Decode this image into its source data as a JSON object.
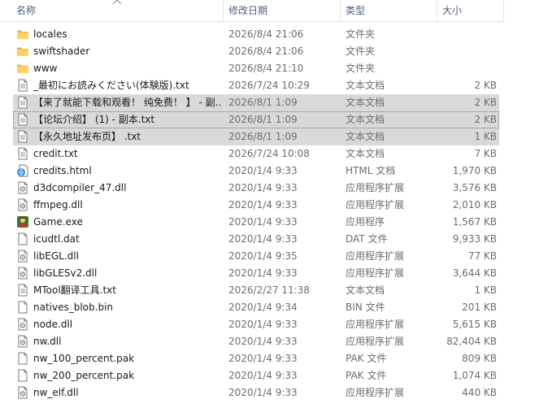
{
  "columns": {
    "name": "名称",
    "date": "修改日期",
    "type": "类型",
    "size": "大小"
  },
  "files": [
    {
      "name": "locales",
      "date": "2026/8/4 21:06",
      "type": "文件夹",
      "size": "",
      "icon": "folder-icon"
    },
    {
      "name": "swiftshader",
      "date": "2026/8/4 21:06",
      "type": "文件夹",
      "size": "",
      "icon": "folder-icon"
    },
    {
      "name": "www",
      "date": "2026/8/4 21:10",
      "type": "文件夹",
      "size": "",
      "icon": "folder-icon"
    },
    {
      "name": "_最初にお読みください(体験版).txt",
      "date": "2026/7/24 10:29",
      "type": "文本文档",
      "size": "2 KB",
      "icon": "text-file-icon"
    },
    {
      "name": "【来了就能下载和观看！ 纯免费！ 】 - 副...",
      "date": "2026/8/1 1:09",
      "type": "文本文档",
      "size": "2 KB",
      "icon": "text-file-icon",
      "selected": true
    },
    {
      "name": "【论坛介绍】 (1) - 副本.txt",
      "date": "2026/8/1 1:09",
      "type": "文本文档",
      "size": "2 KB",
      "icon": "text-file-icon",
      "selected": true,
      "focused": true
    },
    {
      "name": "【永久地址发布页】 .txt",
      "date": "2026/8/1 1:09",
      "type": "文本文档",
      "size": "1 KB",
      "icon": "text-file-icon",
      "selected": true
    },
    {
      "name": "credit.txt",
      "date": "2026/7/24 10:08",
      "type": "文本文档",
      "size": "7 KB",
      "icon": "text-file-icon"
    },
    {
      "name": "credits.html",
      "date": "2020/1/4 9:33",
      "type": "HTML 文档",
      "size": "1,970 KB",
      "icon": "html-file-icon"
    },
    {
      "name": "d3dcompiler_47.dll",
      "date": "2020/1/4 9:33",
      "type": "应用程序扩展",
      "size": "3,576 KB",
      "icon": "dll-file-icon"
    },
    {
      "name": "ffmpeg.dll",
      "date": "2020/1/4 9:33",
      "type": "应用程序扩展",
      "size": "2,010 KB",
      "icon": "dll-file-icon"
    },
    {
      "name": "Game.exe",
      "date": "2020/1/4 9:33",
      "type": "应用程序",
      "size": "1,567 KB",
      "icon": "game-exe-icon"
    },
    {
      "name": "icudtl.dat",
      "date": "2020/1/4 9:33",
      "type": "DAT 文件",
      "size": "9,933 KB",
      "icon": "blank-file-icon"
    },
    {
      "name": "libEGL.dll",
      "date": "2020/1/4 9:35",
      "type": "应用程序扩展",
      "size": "77 KB",
      "icon": "dll-file-icon"
    },
    {
      "name": "libGLESv2.dll",
      "date": "2020/1/4 9:33",
      "type": "应用程序扩展",
      "size": "3,644 KB",
      "icon": "dll-file-icon"
    },
    {
      "name": "MTool翻译工具.txt",
      "date": "2026/2/27 11:38",
      "type": "文本文档",
      "size": "1 KB",
      "icon": "text-file-icon"
    },
    {
      "name": "natives_blob.bin",
      "date": "2020/1/4 9:34",
      "type": "BIN 文件",
      "size": "201 KB",
      "icon": "blank-file-icon"
    },
    {
      "name": "node.dll",
      "date": "2020/1/4 9:33",
      "type": "应用程序扩展",
      "size": "5,615 KB",
      "icon": "dll-file-icon"
    },
    {
      "name": "nw.dll",
      "date": "2020/1/4 9:33",
      "type": "应用程序扩展",
      "size": "82,404 KB",
      "icon": "dll-file-icon"
    },
    {
      "name": "nw_100_percent.pak",
      "date": "2020/1/4 9:33",
      "type": "PAK 文件",
      "size": "809 KB",
      "icon": "blank-file-icon"
    },
    {
      "name": "nw_200_percent.pak",
      "date": "2020/1/4 9:33",
      "type": "PAK 文件",
      "size": "1,074 KB",
      "icon": "blank-file-icon"
    },
    {
      "name": "nw_elf.dll",
      "date": "2020/1/4 9:33",
      "type": "应用程序扩展",
      "size": "440 KB",
      "icon": "dll-file-icon"
    }
  ]
}
